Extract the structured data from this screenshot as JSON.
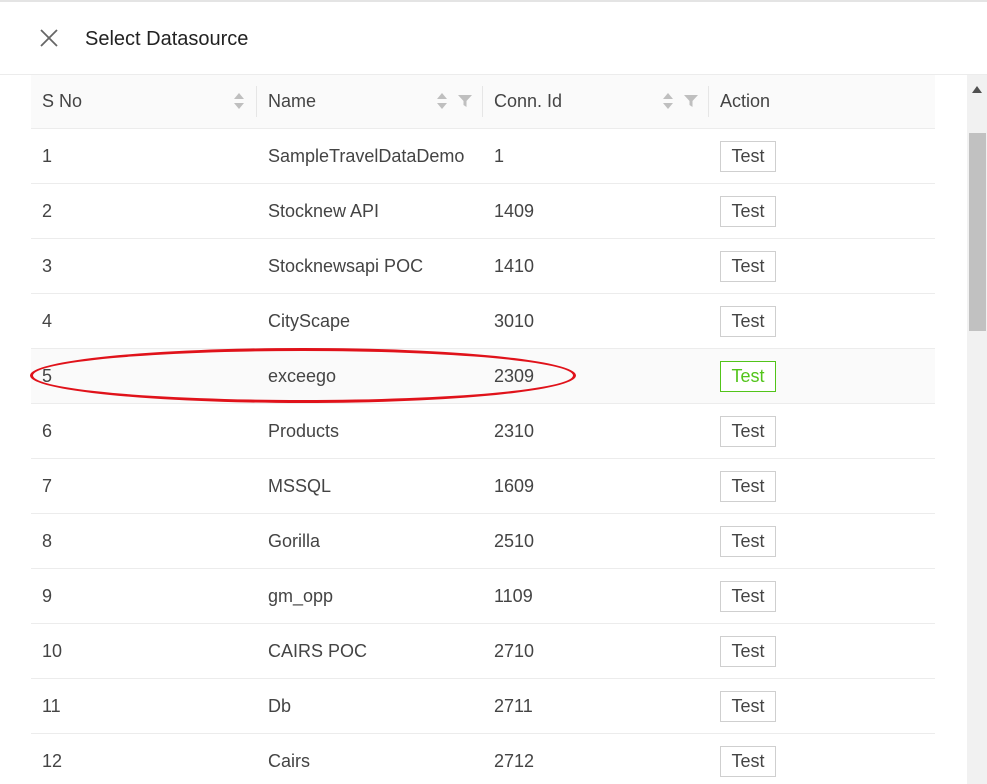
{
  "dialog": {
    "title": "Select Datasource"
  },
  "table": {
    "columns": [
      {
        "label": "S No"
      },
      {
        "label": "Name"
      },
      {
        "label": "Conn. Id"
      },
      {
        "label": "Action"
      }
    ],
    "rows": [
      {
        "sno": "1",
        "name": "SampleTravelDataDemo",
        "conn_id": "1",
        "action": "Test"
      },
      {
        "sno": "2",
        "name": "Stocknew API",
        "conn_id": "1409",
        "action": "Test"
      },
      {
        "sno": "3",
        "name": "Stocknewsapi POC",
        "conn_id": "1410",
        "action": "Test"
      },
      {
        "sno": "4",
        "name": "CityScape",
        "conn_id": "3010",
        "action": "Test"
      },
      {
        "sno": "5",
        "name": "exceego",
        "conn_id": "2309",
        "action": "Test"
      },
      {
        "sno": "6",
        "name": "Products",
        "conn_id": "2310",
        "action": "Test"
      },
      {
        "sno": "7",
        "name": "MSSQL",
        "conn_id": "1609",
        "action": "Test"
      },
      {
        "sno": "8",
        "name": "Gorilla",
        "conn_id": "2510",
        "action": "Test"
      },
      {
        "sno": "9",
        "name": "gm_opp",
        "conn_id": "1109",
        "action": "Test"
      },
      {
        "sno": "10",
        "name": "CAIRS POC",
        "conn_id": "2710",
        "action": "Test"
      },
      {
        "sno": "11",
        "name": "Db",
        "conn_id": "2711",
        "action": "Test"
      },
      {
        "sno": "12",
        "name": "Cairs",
        "conn_id": "2712",
        "action": "Test"
      }
    ],
    "highlighted_row": "5"
  },
  "colors": {
    "accent_green": "#52c41a",
    "annotation_red": "#e0121a"
  },
  "icons": {
    "close": "close-icon",
    "sort": "sort-icon",
    "filter": "filter-icon",
    "scroll_up": "scroll-up-arrow-icon"
  }
}
